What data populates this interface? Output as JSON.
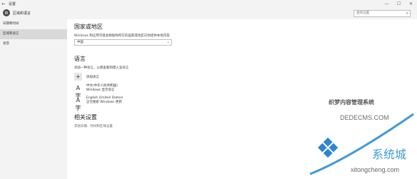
{
  "window": {
    "title": "设置",
    "controls": {
      "minimize": "—",
      "maximize": "☐",
      "close": "✕"
    }
  },
  "header": {
    "page_label": "区域和语言",
    "search_placeholder": "查找设置"
  },
  "sidebar": {
    "items": [
      {
        "label": "日期和时间"
      },
      {
        "label": "区域和语言"
      },
      {
        "label": "语音"
      }
    ]
  },
  "region": {
    "heading": "国家或地区",
    "description": "Windows 和应用可能会根据你所在的国家或地区向你提供本地内容",
    "selected_country": "中国"
  },
  "language": {
    "heading": "语言",
    "description": "添加一种语言，以便查看和键入该语言",
    "add_label": "添加语言",
    "items": [
      {
        "name": "中文(中华人民共和国)",
        "detail": "Windows 显示语言"
      },
      {
        "name": "English (United States)",
        "detail": "正在搜索 Windows 更新"
      }
    ]
  },
  "related": {
    "heading": "相关设置",
    "description": "其他日期、时间和区域设置"
  },
  "watermark": {
    "site1": "织梦内容管理系统",
    "site2": "DEDECMS.COM",
    "brand": "系统城",
    "cms": "",
    "sub": "xitongcheng.com"
  }
}
